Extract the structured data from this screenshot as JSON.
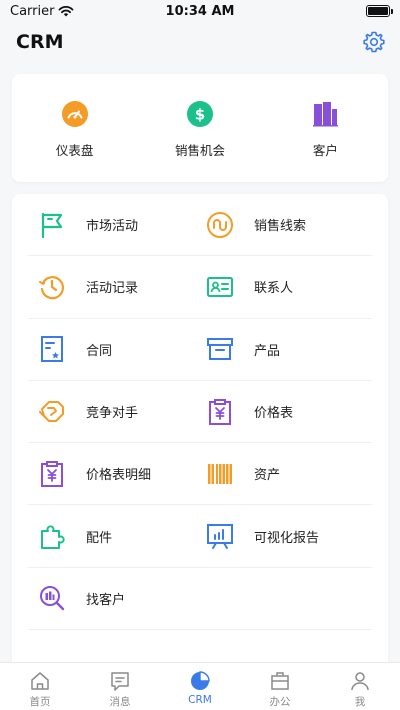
{
  "status_bar": {
    "carrier": "Carrier",
    "time": "10:34 AM"
  },
  "header": {
    "title": "CRM"
  },
  "quick_actions": [
    {
      "label": "仪表盘",
      "icon": "dashboard-icon",
      "color": "#f39c27"
    },
    {
      "label": "销售机会",
      "icon": "dollar-icon",
      "color": "#1cc08a"
    },
    {
      "label": "客户",
      "icon": "building-icon",
      "color": "#8a4fd9"
    }
  ],
  "modules": [
    {
      "label": "市场活动",
      "icon": "flag-icon",
      "color": "#1cc08a"
    },
    {
      "label": "销售线索",
      "icon": "leads-icon",
      "color": "#f39c27"
    },
    {
      "label": "活动记录",
      "icon": "history-icon",
      "color": "#f39c27"
    },
    {
      "label": "联系人",
      "icon": "contact-card-icon",
      "color": "#1cc08a"
    },
    {
      "label": "合同",
      "icon": "contract-icon",
      "color": "#3a7be8"
    },
    {
      "label": "产品",
      "icon": "product-box-icon",
      "color": "#3a7be8"
    },
    {
      "label": "竞争对手",
      "icon": "fist-icon",
      "color": "#f39c27"
    },
    {
      "label": "价格表",
      "icon": "price-list-icon",
      "color": "#8a4fd9"
    },
    {
      "label": "价格表明细",
      "icon": "price-detail-icon",
      "color": "#8a4fd9"
    },
    {
      "label": "资产",
      "icon": "barcode-icon",
      "color": "#f39c27"
    },
    {
      "label": "配件",
      "icon": "puzzle-icon",
      "color": "#1cc08a"
    },
    {
      "label": "可视化报告",
      "icon": "chart-board-icon",
      "color": "#3a7be8"
    },
    {
      "label": "找客户",
      "icon": "search-customer-icon",
      "color": "#8a4fd9"
    }
  ],
  "tabs": [
    {
      "label": "首页",
      "icon": "home-icon",
      "active": false
    },
    {
      "label": "消息",
      "icon": "message-icon",
      "active": false
    },
    {
      "label": "CRM",
      "icon": "pie-chart-icon",
      "active": true
    },
    {
      "label": "办公",
      "icon": "briefcase-icon",
      "active": false
    },
    {
      "label": "我",
      "icon": "user-icon",
      "active": false
    }
  ],
  "colors": {
    "accent": "#3a7be8",
    "orange": "#f39c27",
    "green": "#1cc08a",
    "purple": "#8a4fd9"
  }
}
